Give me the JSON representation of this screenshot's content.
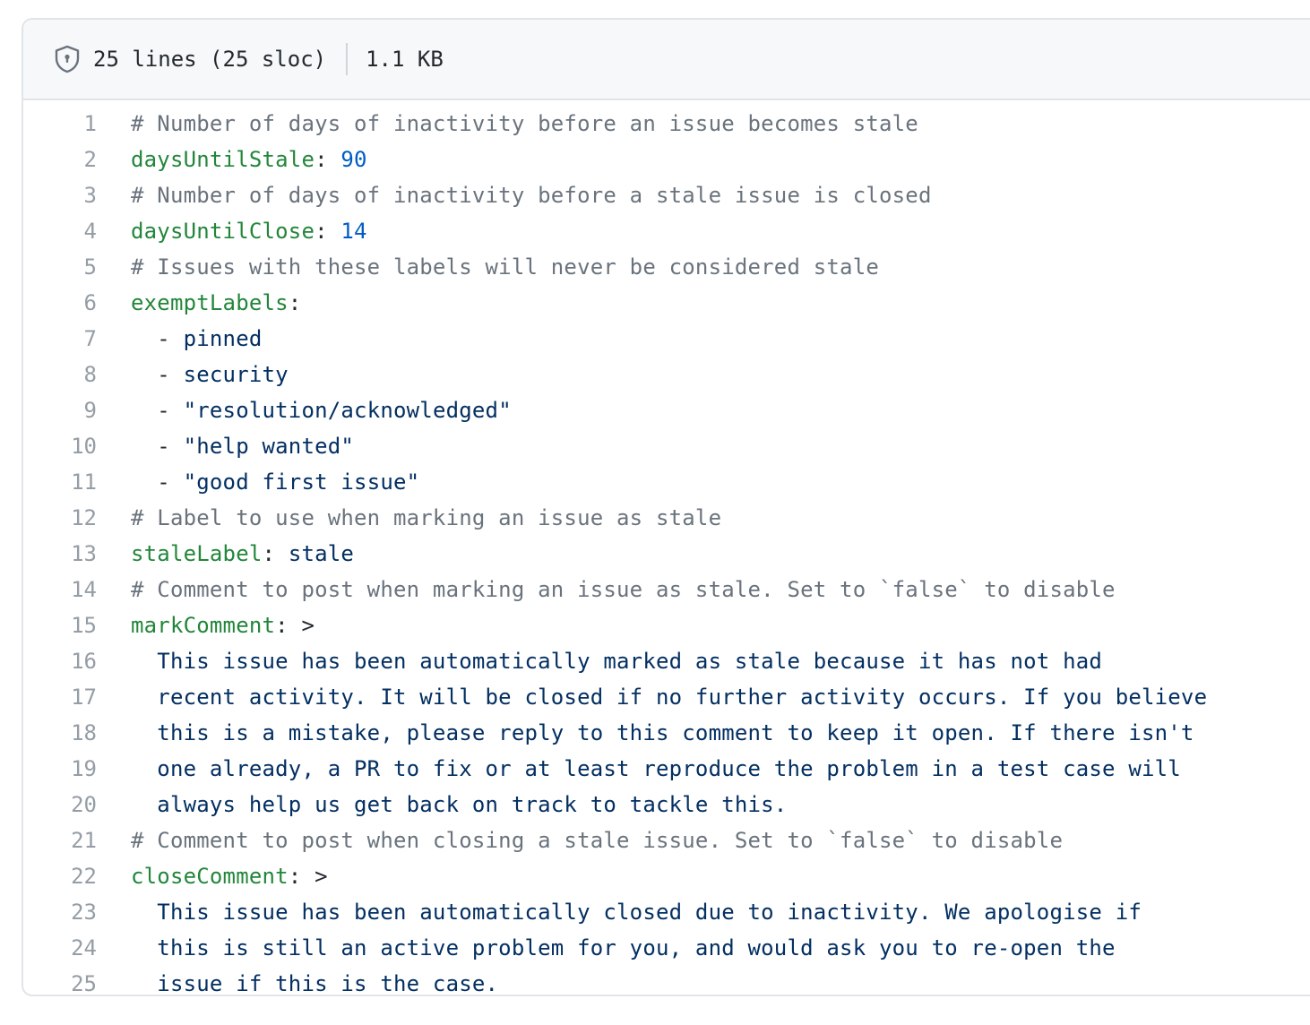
{
  "header": {
    "lines_info": "25 lines (25 sloc)",
    "size": "1.1 KB",
    "icon": "shield-icon"
  },
  "colors": {
    "comment": "#6a737d",
    "key": "#22863a",
    "number": "#005cc5",
    "string": "#032f62",
    "line_number": "#959da5"
  },
  "code_lines": [
    {
      "num": "1",
      "tokens": [
        {
          "t": "comment",
          "v": "# Number of days of inactivity before an issue becomes stale"
        }
      ]
    },
    {
      "num": "2",
      "tokens": [
        {
          "t": "key",
          "v": "daysUntilStale"
        },
        {
          "t": "plain",
          "v": ": "
        },
        {
          "t": "num",
          "v": "90"
        }
      ]
    },
    {
      "num": "3",
      "tokens": [
        {
          "t": "comment",
          "v": "# Number of days of inactivity before a stale issue is closed"
        }
      ]
    },
    {
      "num": "4",
      "tokens": [
        {
          "t": "key",
          "v": "daysUntilClose"
        },
        {
          "t": "plain",
          "v": ": "
        },
        {
          "t": "num",
          "v": "14"
        }
      ]
    },
    {
      "num": "5",
      "tokens": [
        {
          "t": "comment",
          "v": "# Issues with these labels will never be considered stale"
        }
      ]
    },
    {
      "num": "6",
      "tokens": [
        {
          "t": "key",
          "v": "exemptLabels"
        },
        {
          "t": "plain",
          "v": ":"
        }
      ]
    },
    {
      "num": "7",
      "tokens": [
        {
          "t": "plain",
          "v": "  - "
        },
        {
          "t": "str",
          "v": "pinned"
        }
      ]
    },
    {
      "num": "8",
      "tokens": [
        {
          "t": "plain",
          "v": "  - "
        },
        {
          "t": "str",
          "v": "security"
        }
      ]
    },
    {
      "num": "9",
      "tokens": [
        {
          "t": "plain",
          "v": "  - "
        },
        {
          "t": "str",
          "v": "\"resolution/acknowledged\""
        }
      ]
    },
    {
      "num": "10",
      "tokens": [
        {
          "t": "plain",
          "v": "  - "
        },
        {
          "t": "str",
          "v": "\"help wanted\""
        }
      ]
    },
    {
      "num": "11",
      "tokens": [
        {
          "t": "plain",
          "v": "  - "
        },
        {
          "t": "str",
          "v": "\"good first issue\""
        }
      ]
    },
    {
      "num": "12",
      "tokens": [
        {
          "t": "comment",
          "v": "# Label to use when marking an issue as stale"
        }
      ]
    },
    {
      "num": "13",
      "tokens": [
        {
          "t": "key",
          "v": "staleLabel"
        },
        {
          "t": "plain",
          "v": ": "
        },
        {
          "t": "str",
          "v": "stale"
        }
      ]
    },
    {
      "num": "14",
      "tokens": [
        {
          "t": "comment",
          "v": "# Comment to post when marking an issue as stale. Set to `false` to disable"
        }
      ]
    },
    {
      "num": "15",
      "tokens": [
        {
          "t": "key",
          "v": "markComment"
        },
        {
          "t": "plain",
          "v": ": >"
        }
      ]
    },
    {
      "num": "16",
      "tokens": [
        {
          "t": "str",
          "v": "  This issue has been automatically marked as stale because it has not had"
        }
      ]
    },
    {
      "num": "17",
      "tokens": [
        {
          "t": "str",
          "v": "  recent activity. It will be closed if no further activity occurs. If you believe"
        }
      ]
    },
    {
      "num": "18",
      "tokens": [
        {
          "t": "str",
          "v": "  this is a mistake, please reply to this comment to keep it open. If there isn't"
        }
      ]
    },
    {
      "num": "19",
      "tokens": [
        {
          "t": "str",
          "v": "  one already, a PR to fix or at least reproduce the problem in a test case will"
        }
      ]
    },
    {
      "num": "20",
      "tokens": [
        {
          "t": "str",
          "v": "  always help us get back on track to tackle this."
        }
      ]
    },
    {
      "num": "21",
      "tokens": [
        {
          "t": "comment",
          "v": "# Comment to post when closing a stale issue. Set to `false` to disable"
        }
      ]
    },
    {
      "num": "22",
      "tokens": [
        {
          "t": "key",
          "v": "closeComment"
        },
        {
          "t": "plain",
          "v": ": >"
        }
      ]
    },
    {
      "num": "23",
      "tokens": [
        {
          "t": "str",
          "v": "  This issue has been automatically closed due to inactivity. We apologise if"
        }
      ]
    },
    {
      "num": "24",
      "tokens": [
        {
          "t": "str",
          "v": "  this is still an active problem for you, and would ask you to re-open the"
        }
      ]
    },
    {
      "num": "25",
      "tokens": [
        {
          "t": "str",
          "v": "  issue if this is the case."
        }
      ]
    }
  ]
}
